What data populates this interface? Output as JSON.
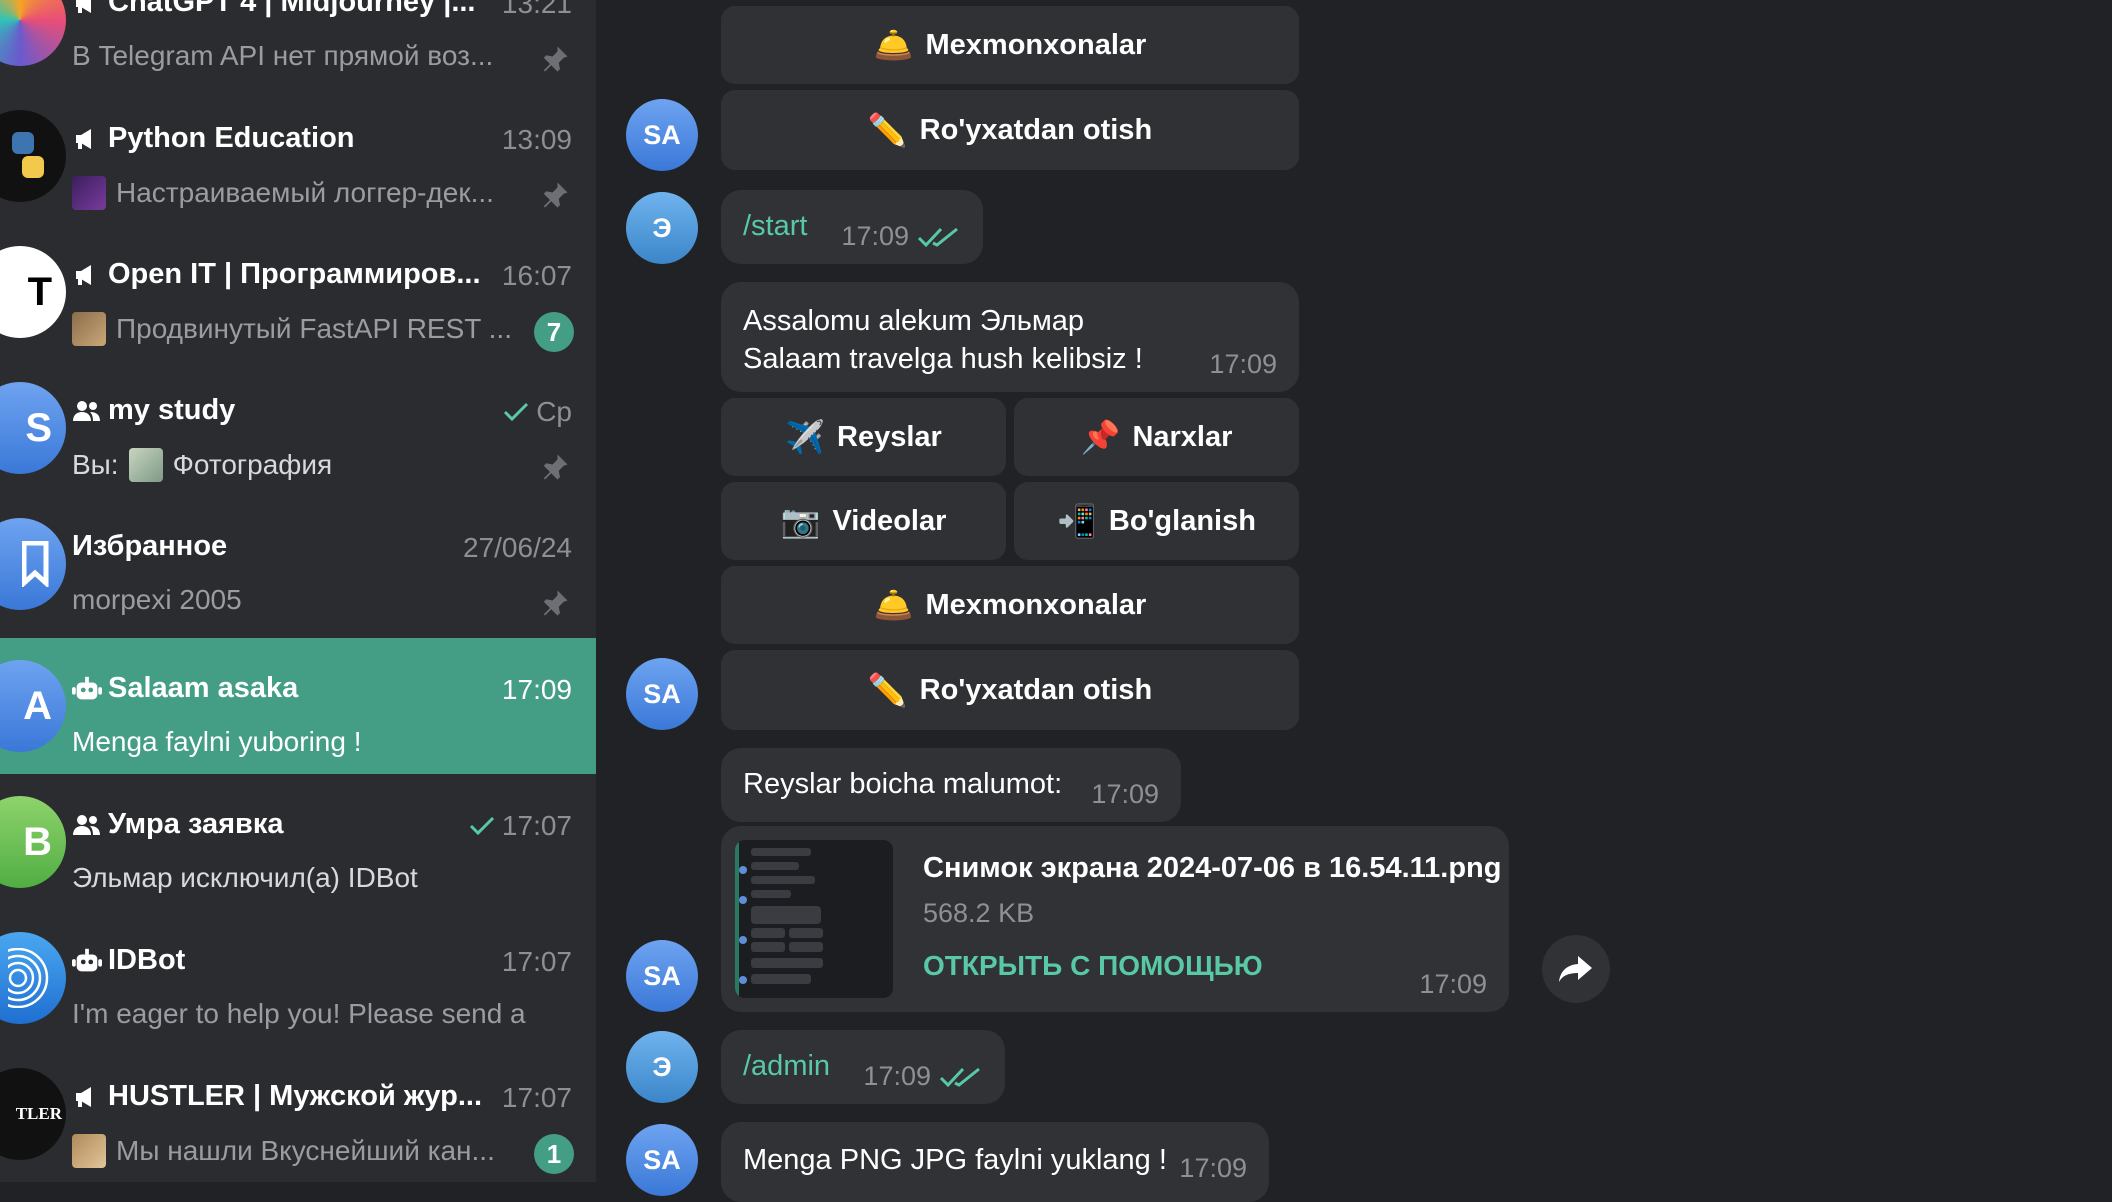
{
  "sidebar": {
    "chats": [
      {
        "title": "ChatGPT 4 | Midjourney |...",
        "time": "13:21",
        "preview": "В Telegram API нет прямой воз..."
      },
      {
        "title": "Python Education",
        "time": "13:09",
        "preview": "Настраиваемый логгер-дек..."
      },
      {
        "title": "Open IT | Программиров...",
        "time": "16:07",
        "preview": "Продвинутый FastAPI REST ...",
        "badge": "7"
      },
      {
        "title": "my study",
        "time": "Ср",
        "preview_prefix": "Вы:",
        "preview": "Фотография"
      },
      {
        "title": "Избранное",
        "time": "27/06/24",
        "preview": "morpexi 2005"
      },
      {
        "title": "Salaam asaka",
        "time": "17:09",
        "preview": "Menga faylni yuboring !"
      },
      {
        "title": "Умра заявка",
        "time": "17:07",
        "preview": "Эльмар исключил(а) IDBot"
      },
      {
        "title": "IDBot",
        "time": "17:07",
        "preview": "I'm eager to help you! Please send a ..."
      },
      {
        "title": "HUSTLER | Мужской жур...",
        "time": "17:07",
        "preview": "Мы нашли Вкуснейший кан...",
        "badge": "1"
      }
    ],
    "avatars": {
      "openit": "T",
      "mystudy": "S",
      "salaam": "A",
      "umra": "В",
      "hustler": "TLER"
    }
  },
  "chat": {
    "sa_initials": "SA",
    "e_initials": "Э",
    "top_buttons": {
      "mexmonxonalar": "Mexmonxonalar",
      "royxatdan": "Ro'yxatdan otish"
    },
    "start_msg": {
      "text": "/start",
      "time": "17:09"
    },
    "welcome": {
      "line1": "Assalomu alekum Эльмар",
      "line2": "Salaam travelga hush kelibsiz !",
      "time": "17:09"
    },
    "buttons": {
      "reyslar": "Reyslar",
      "narxlar": "Narxlar",
      "videolar": "Videolar",
      "boglanish": "Bo'glanish",
      "mexmonxonalar": "Mexmonxonalar",
      "royxatdan": "Ro'yxatdan otish"
    },
    "emoji": {
      "plane": "✈️",
      "pin": "📌",
      "camera": "📷",
      "phone": "📲",
      "bell": "🛎️",
      "pencil": "✏️"
    },
    "reys_msg": {
      "text": "Reyslar boicha malumot:",
      "time": "17:09"
    },
    "file": {
      "name": "Снимок экрана 2024-07-06 в 16.54.11.png",
      "size": "568.2 KB",
      "action": "ОТКРЫТЬ С ПОМОЩЬЮ",
      "time": "17:09"
    },
    "admin_msg": {
      "text": "/admin",
      "time": "17:09"
    },
    "upload_msg": {
      "text": "Menga PNG JPG faylni yuklang !",
      "time": "17:09"
    }
  },
  "colors": {
    "accent": "#439e85",
    "link": "#58c9a4",
    "bubble": "#303236",
    "sidebar": "#2b2c30",
    "background": "#212225"
  }
}
